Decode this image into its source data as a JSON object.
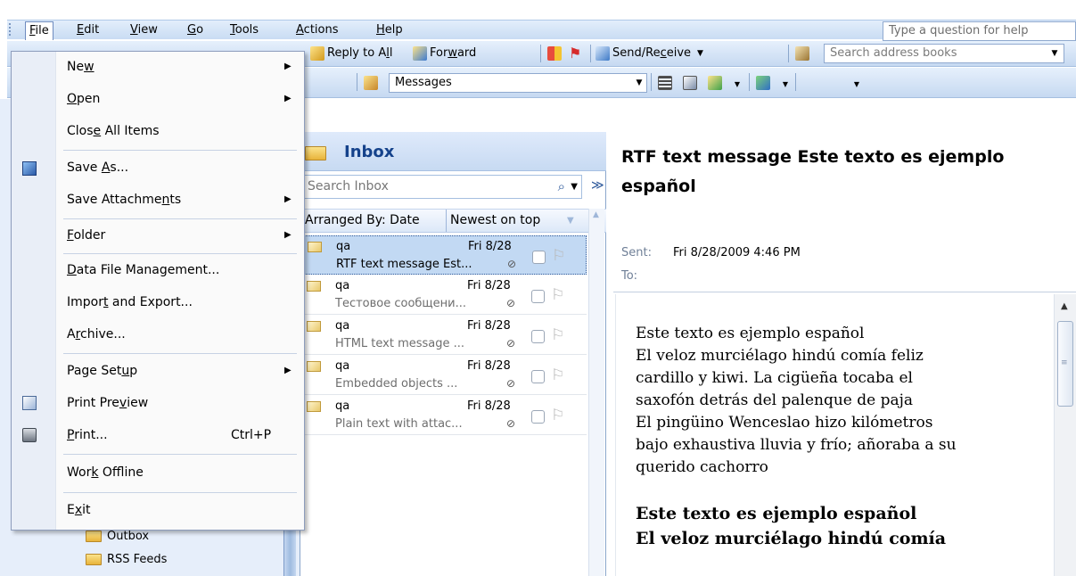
{
  "menubar": {
    "items": [
      {
        "label": "File",
        "u": "F",
        "rest": "ile"
      },
      {
        "label": "Edit",
        "u": "E",
        "rest": "dit"
      },
      {
        "label": "View",
        "u": "V",
        "rest": "iew"
      },
      {
        "label": "Go",
        "u": "G",
        "rest": "o"
      },
      {
        "label": "Tools",
        "u": "T",
        "rest": "ools"
      },
      {
        "label": "Actions",
        "u": "A",
        "rest": "ctions"
      },
      {
        "label": "Help",
        "u": "H",
        "rest": "elp"
      }
    ],
    "help_placeholder": "Type a question for help"
  },
  "toolbar1": {
    "reply_all": {
      "pre": "Reply to A",
      "u": "l",
      "post": "l"
    },
    "forward": {
      "pre": "For",
      "u": "w",
      "post": "ard"
    },
    "send_receive": {
      "pre": "Send/Re",
      "u": "c",
      "post": "eive"
    },
    "search_address": "Search address books"
  },
  "toolbar2": {
    "view_select": "Messages"
  },
  "navpane": {
    "folders": [
      "Outbox",
      "RSS Feeds"
    ]
  },
  "inbox": {
    "title": "Inbox",
    "search_placeholder": "Search Inbox",
    "arranged_by": "Arranged By: Date",
    "sort_order": "Newest on top",
    "messages": [
      {
        "from": "qa",
        "date": "Fri 8/28",
        "subject": "RTF text message Est...",
        "selected": true
      },
      {
        "from": "qa",
        "date": "Fri 8/28",
        "subject": "Тестовое сообщени..."
      },
      {
        "from": "qa",
        "date": "Fri 8/28",
        "subject": "HTML text message ..."
      },
      {
        "from": "qa",
        "date": "Fri 8/28",
        "subject": "Embedded objects ..."
      },
      {
        "from": "qa",
        "date": "Fri 8/28",
        "subject": "Plain text with attac..."
      }
    ]
  },
  "reading": {
    "subject": "RTF text message Este texto es ejemplo español",
    "sent_label": "Sent:",
    "sent_value": "Fri 8/28/2009 4:46 PM",
    "to_label": "To:",
    "body_lines": [
      "Este texto es ejemplo español",
      "El veloz murciélago hindú comía feliz",
      "cardillo y kiwi. La cigüeña tocaba el",
      "saxofón detrás del palenque de paja",
      "El pingüino Wenceslao hizo kilómetros",
      "bajo exhaustiva lluvia y frío; añoraba a su",
      "querido cachorro"
    ],
    "bold_lines": [
      "Este texto es ejemplo español",
      "El veloz murciélago hindú comía"
    ]
  },
  "file_menu": {
    "new": {
      "pre": "Ne",
      "u": "w",
      "post": ""
    },
    "open": {
      "pre": "",
      "u": "O",
      "post": "pen"
    },
    "close_all": {
      "pre": "Clos",
      "u": "e",
      "post": " All Items"
    },
    "save_as": {
      "pre": "Save ",
      "u": "A",
      "post": "s..."
    },
    "save_attachments": {
      "pre": "Save Attachme",
      "u": "n",
      "post": "ts"
    },
    "folder": {
      "pre": "",
      "u": "F",
      "post": "older"
    },
    "data_file": {
      "pre": "",
      "u": "D",
      "post": "ata File Management..."
    },
    "import_export": {
      "pre": "Impor",
      "u": "t",
      "post": " and Export..."
    },
    "archive": {
      "pre": "A",
      "u": "r",
      "post": "chive..."
    },
    "page_setup": {
      "pre": "Page Set",
      "u": "u",
      "post": "p"
    },
    "print_preview": {
      "pre": "Print Pre",
      "u": "v",
      "post": "iew"
    },
    "print": {
      "pre": "",
      "u": "P",
      "post": "rint..."
    },
    "print_shortcut": "Ctrl+P",
    "work_offline": {
      "pre": "Wor",
      "u": "k",
      "post": " Offline"
    },
    "exit": {
      "pre": "E",
      "u": "x",
      "post": "it"
    }
  }
}
